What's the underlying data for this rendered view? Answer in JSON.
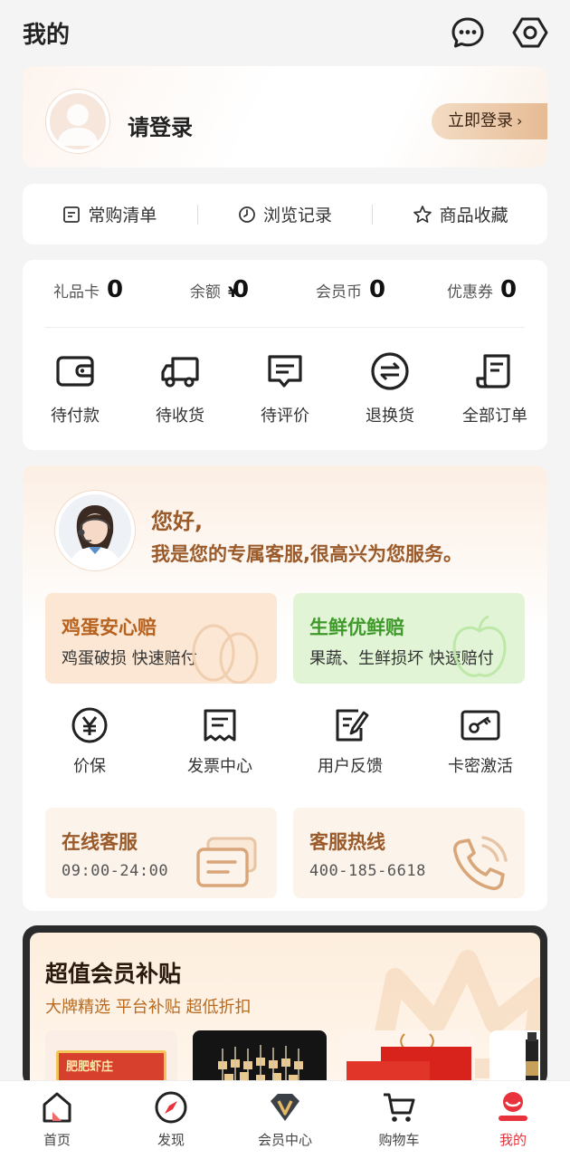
{
  "header": {
    "title": "我的"
  },
  "login": {
    "prompt": "请登录",
    "button": "立即登录",
    "button_arrow": "›"
  },
  "shortcuts": [
    {
      "label": "常购清单",
      "icon": "list-icon"
    },
    {
      "label": "浏览记录",
      "icon": "clock-icon"
    },
    {
      "label": "商品收藏",
      "icon": "star-icon"
    }
  ],
  "assets": {
    "gift_card": {
      "label": "礼品卡",
      "value": "0"
    },
    "balance": {
      "label": "余额",
      "currency": "¥",
      "value": "0"
    },
    "coins": {
      "label": "会员币",
      "value": "0"
    },
    "coupons": {
      "label": "优惠券",
      "value": "0"
    }
  },
  "orders": [
    {
      "label": "待付款",
      "icon": "wallet-icon"
    },
    {
      "label": "待收货",
      "icon": "truck-icon"
    },
    {
      "label": "待评价",
      "icon": "comment-icon"
    },
    {
      "label": "退换货",
      "icon": "exchange-icon"
    },
    {
      "label": "全部订单",
      "icon": "receipt-icon"
    }
  ],
  "service": {
    "greeting_line1": "您好,",
    "greeting_line2": "我是您的专属客服,很高兴为您服务。",
    "egg": {
      "title": "鸡蛋安心赔",
      "subtitle": "鸡蛋破损 快速赔付"
    },
    "fresh": {
      "title": "生鲜优鲜赔",
      "subtitle": "果蔬、生鲜损坏 快速赔付"
    },
    "tools": [
      {
        "label": "价保",
        "icon": "yen-circle-icon"
      },
      {
        "label": "发票中心",
        "icon": "invoice-icon"
      },
      {
        "label": "用户反馈",
        "icon": "feedback-icon"
      },
      {
        "label": "卡密激活",
        "icon": "key-card-icon"
      }
    ],
    "online": {
      "title": "在线客服",
      "hours": "09:00-24:00"
    },
    "hotline": {
      "title": "客服热线",
      "number": "400-185-6618"
    }
  },
  "vip": {
    "title": "超值会员补贴",
    "subtitle": "大牌精选 平台补贴 超低折扣",
    "product_brand": "肥肥虾庄"
  },
  "nav": [
    {
      "label": "首页",
      "icon": "home-icon"
    },
    {
      "label": "发现",
      "icon": "compass-icon"
    },
    {
      "label": "会员中心",
      "icon": "vip-icon"
    },
    {
      "label": "购物车",
      "icon": "cart-icon"
    },
    {
      "label": "我的",
      "icon": "profile-icon",
      "active": true
    }
  ],
  "colors": {
    "accent": "#e8323c",
    "gold": "#9a5a2a",
    "egg": "#b8621f",
    "fresh": "#3f9a2b"
  }
}
